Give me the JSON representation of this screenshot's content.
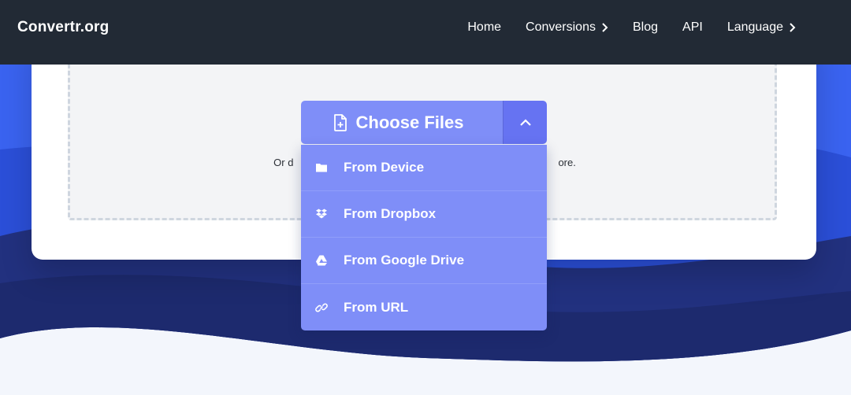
{
  "brand": {
    "name": "Convertr.org"
  },
  "nav": {
    "home": "Home",
    "conversions": "Conversions",
    "blog": "Blog",
    "api": "API",
    "language": "Language"
  },
  "upload": {
    "choose_label": "Choose Files",
    "hint_left": "Or d",
    "hint_right": "ore."
  },
  "dropdown": {
    "items": [
      {
        "label": "From Device",
        "icon": "folder-icon"
      },
      {
        "label": "From Dropbox",
        "icon": "dropbox-icon"
      },
      {
        "label": "From Google Drive",
        "icon": "google-drive-icon"
      },
      {
        "label": "From URL",
        "icon": "link-icon"
      }
    ]
  },
  "colors": {
    "navbar": "#222a35",
    "accent": "#7f8ef8",
    "accent_dark": "#6673f2",
    "hero_blue": "#2f55e8",
    "hero_navy": "#1f2e78"
  }
}
